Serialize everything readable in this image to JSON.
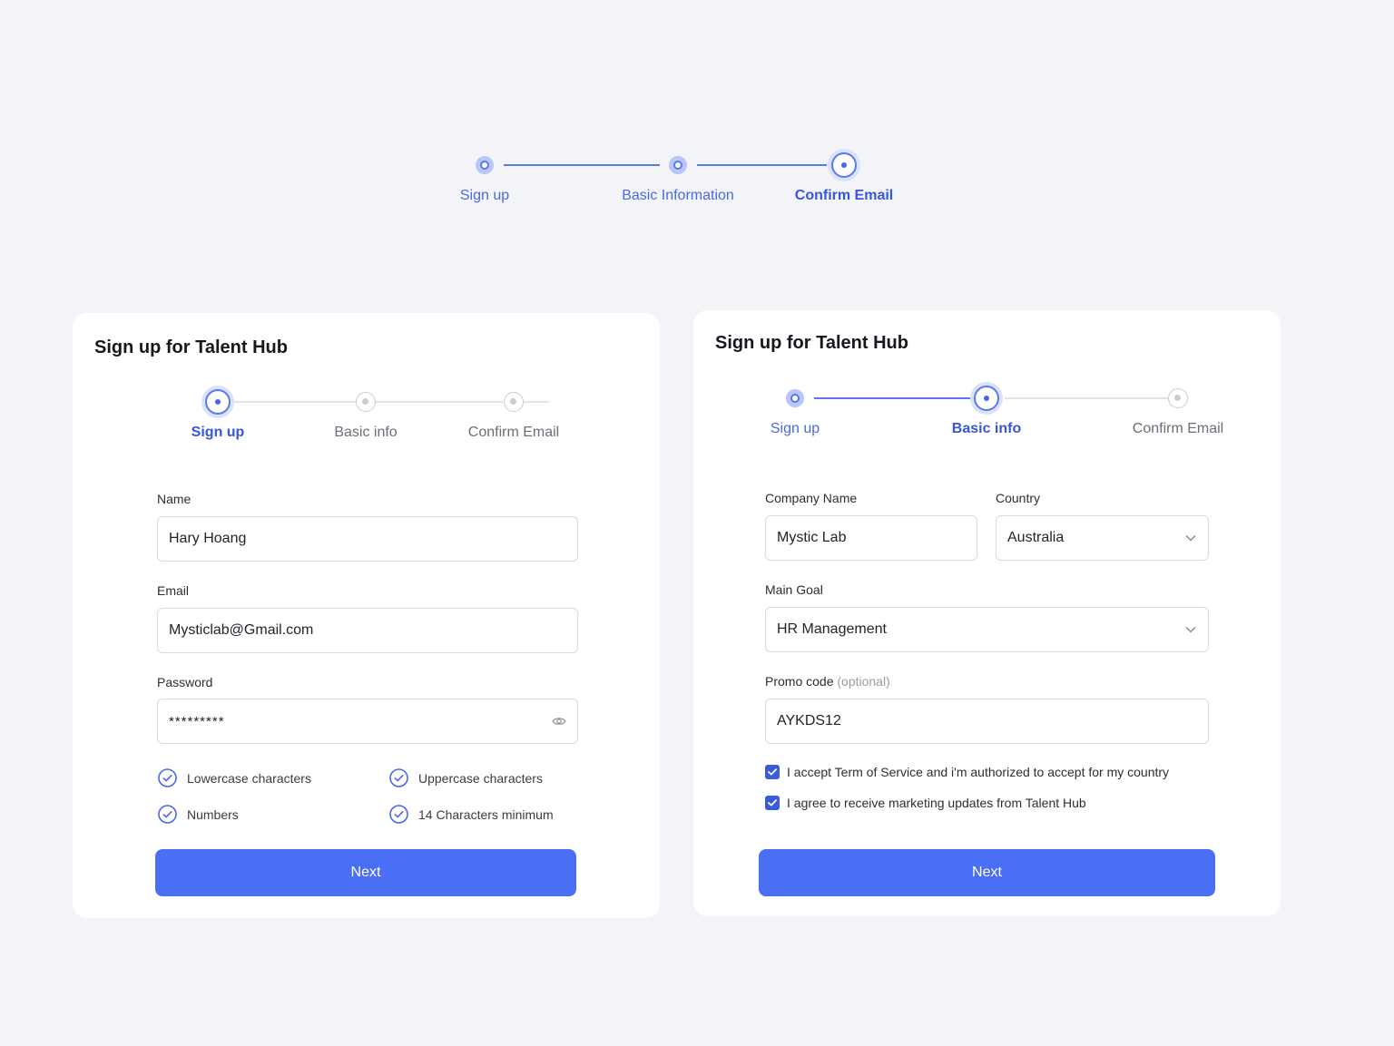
{
  "colors": {
    "accent": "#4a6ff5",
    "background": "#f3f4f8",
    "card": "#ffffff"
  },
  "top_stepper": {
    "steps": [
      {
        "label": "Sign up",
        "state": "done"
      },
      {
        "label": "Basic Information",
        "state": "done"
      },
      {
        "label": "Confirm Email",
        "state": "active"
      }
    ]
  },
  "signup_card": {
    "title": "Sign up for Talent Hub",
    "steps": [
      {
        "label": "Sign up",
        "state": "active"
      },
      {
        "label": "Basic info",
        "state": "todo"
      },
      {
        "label": "Confirm Email",
        "state": "todo"
      }
    ],
    "name_label": "Name",
    "name_value": "Hary Hoang",
    "email_label": "Email",
    "email_value": "Mysticlab@Gmail.com",
    "password_label": "Password",
    "password_value": "*********",
    "password_icon": "eye-icon",
    "requirements": [
      {
        "label": "Lowercase characters",
        "met": true
      },
      {
        "label": "Uppercase characters",
        "met": true
      },
      {
        "label": "Numbers",
        "met": true
      },
      {
        "label": "14 Characters minimum",
        "met": true
      }
    ],
    "next_label": "Next"
  },
  "basic_info_card": {
    "title": "Sign up for Talent Hub",
    "steps": [
      {
        "label": "Sign up",
        "state": "done"
      },
      {
        "label": "Basic info",
        "state": "active"
      },
      {
        "label": "Confirm Email",
        "state": "todo"
      }
    ],
    "company_label": "Company Name",
    "company_value": "Mystic Lab",
    "country_label": "Country",
    "country_value": "Australia",
    "goal_label": "Main Goal",
    "goal_value": "HR Management",
    "promo_label": "Promo code",
    "promo_optional": "(optional)",
    "promo_value": "AYKDS12",
    "checkboxes": [
      {
        "label": "I accept Term of Service and i'm authorized to accept for my country",
        "checked": true
      },
      {
        "label": "I agree to receive marketing updates from Talent Hub",
        "checked": true
      }
    ],
    "next_label": "Next"
  }
}
